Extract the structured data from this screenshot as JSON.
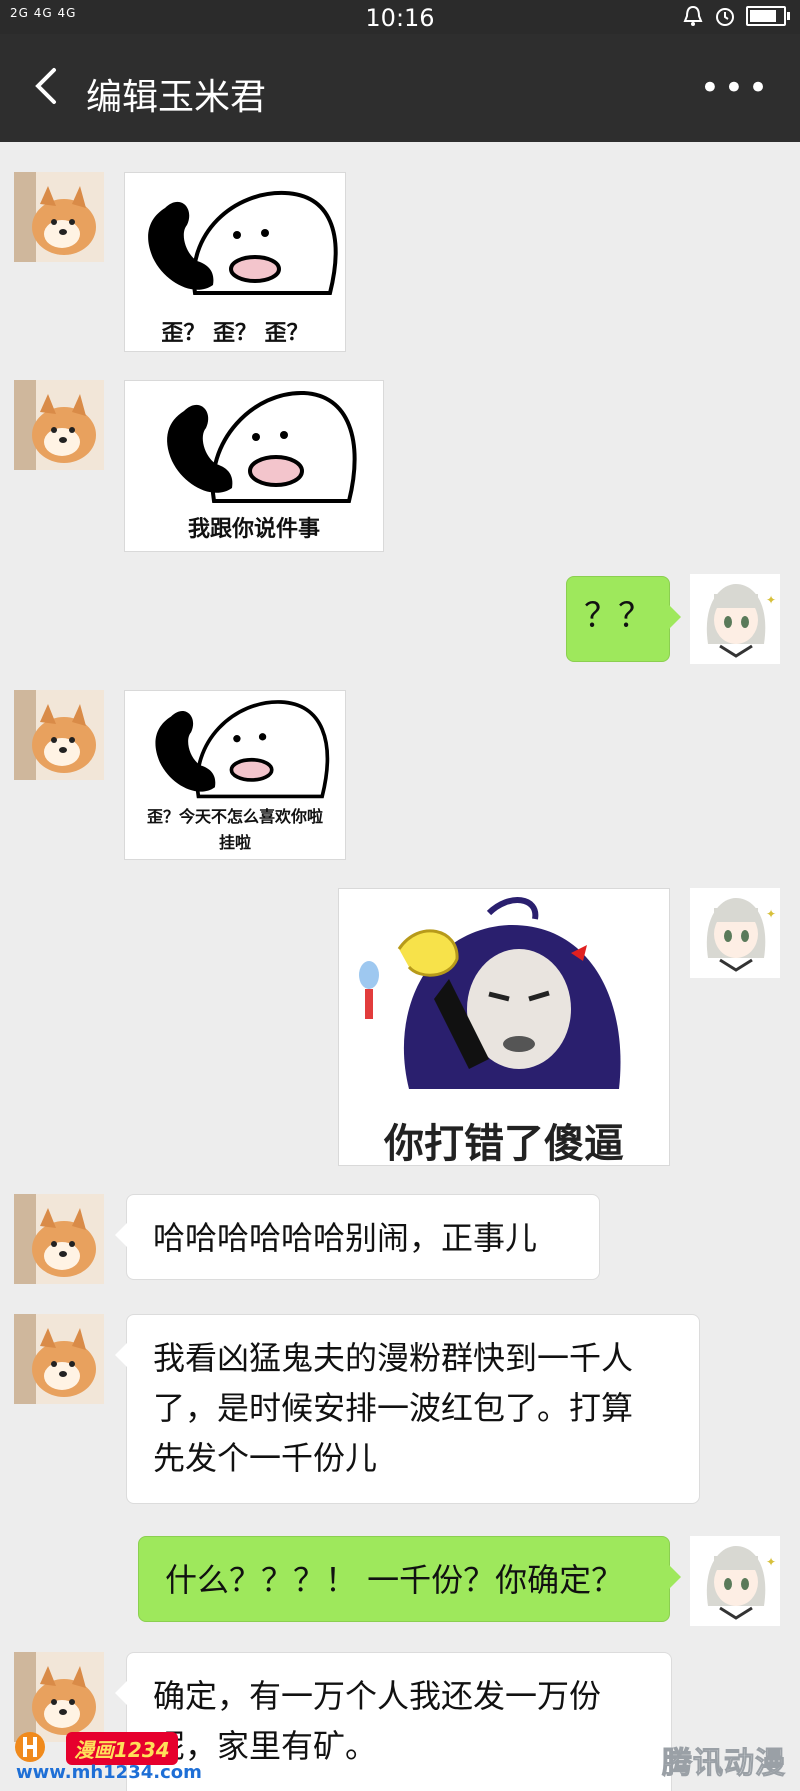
{
  "status_bar": {
    "signal": "2G 4G 4G",
    "time": "10:16",
    "battery_level": 0.8
  },
  "header": {
    "title": "编辑玉米君",
    "more": "•••"
  },
  "messages": [
    {
      "type": "sticker",
      "side": "left",
      "caption": "歪？ 歪？ 歪？"
    },
    {
      "type": "sticker",
      "side": "left",
      "caption": "我跟你说件事"
    },
    {
      "type": "text",
      "side": "right",
      "text": "？？"
    },
    {
      "type": "sticker",
      "side": "left",
      "caption_line1": "歪？今天不怎么喜欢你啦",
      "caption_line2": "挂啦"
    },
    {
      "type": "sticker",
      "side": "right",
      "caption": "你打错了傻逼"
    },
    {
      "type": "text",
      "side": "left",
      "text": "哈哈哈哈哈哈别闹，正事儿"
    },
    {
      "type": "text",
      "side": "left",
      "line1": "我看凶猛鬼夫的漫粉群快到一千人",
      "line2": "了，是时候安排一波红包了。打算",
      "line3": "先发个一千份儿"
    },
    {
      "type": "text",
      "side": "right",
      "text": "什么？？？！ 一千份？你确定？"
    },
    {
      "type": "text",
      "side": "left",
      "line1": "确定，有一万个人我还发一万份",
      "line2": "呢，家里有矿。"
    }
  ],
  "watermarks": {
    "left_logo": "漫画1234",
    "left_url": "www.mh1234.com",
    "right": "腾讯动漫"
  },
  "colors": {
    "header_bg": "#2e2e2e",
    "chat_bg": "#ededed",
    "sent_bubble": "#9ee85c",
    "received_bubble": "#ffffff"
  }
}
